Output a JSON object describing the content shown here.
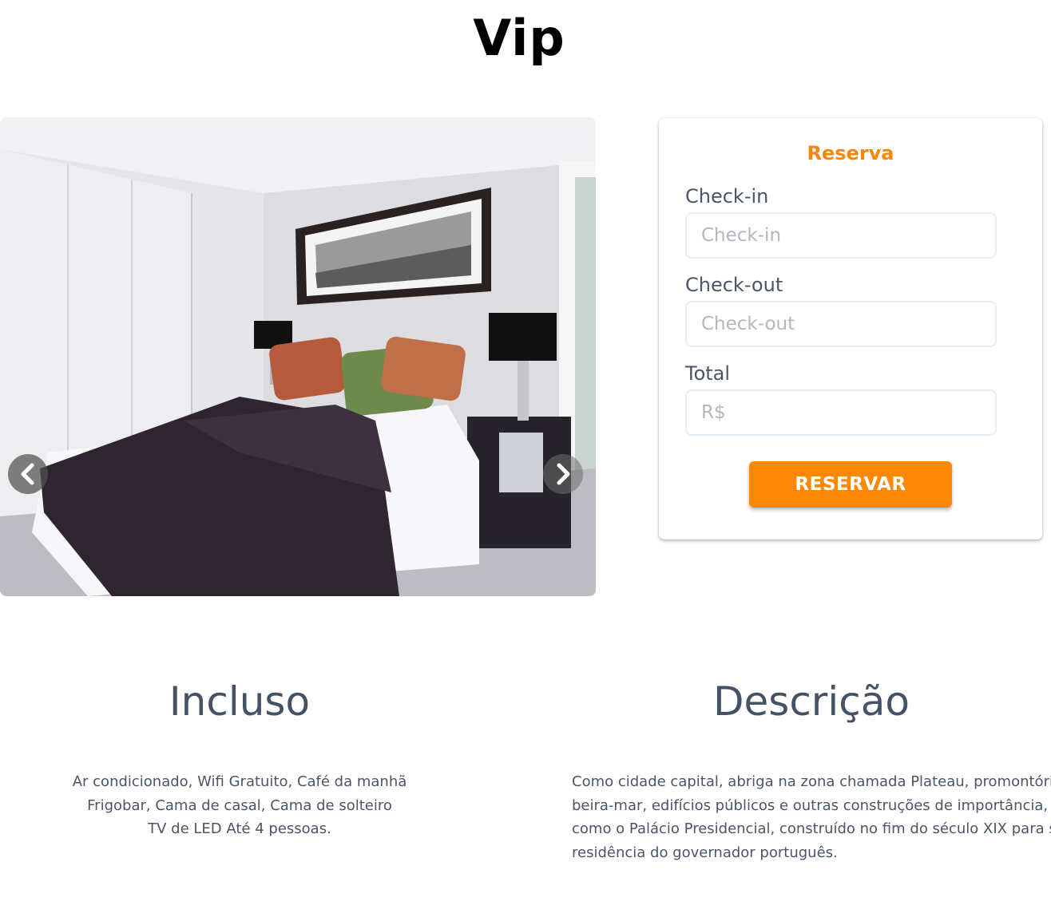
{
  "page": {
    "title": "Vip"
  },
  "carousel": {
    "image_alt": "bedroom-photo",
    "prev_icon": "chevron-left-icon",
    "next_icon": "chevron-right-icon"
  },
  "booking": {
    "title": "Reserva",
    "checkin_label": "Check-in",
    "checkin_placeholder": "Check-in",
    "checkin_value": "",
    "checkout_label": "Check-out",
    "checkout_placeholder": "Check-out",
    "checkout_value": "",
    "total_label": "Total",
    "total_placeholder": "R$",
    "total_value": "",
    "reserve_button": "RESERVAR"
  },
  "included": {
    "heading": "Incluso",
    "lines": [
      "Ar condicionado, Wifi Gratuito, Café da manhã",
      "Frigobar, Cama de casal, Cama de solteiro",
      "TV de LED Até 4 pessoas."
    ]
  },
  "description": {
    "heading": "Descrição",
    "lines": [
      "Como cidade capital, abriga na zona chamada Plateau, promontório à",
      "beira-mar, edifícios públicos e outras construções de importância,",
      "como o Palácio Presidencial, construído no fim do século XIX para ser a",
      "residência do governador português."
    ]
  },
  "colors": {
    "accent": "#fd8805",
    "heading_text": "#445266",
    "body_text": "#4a5668"
  }
}
